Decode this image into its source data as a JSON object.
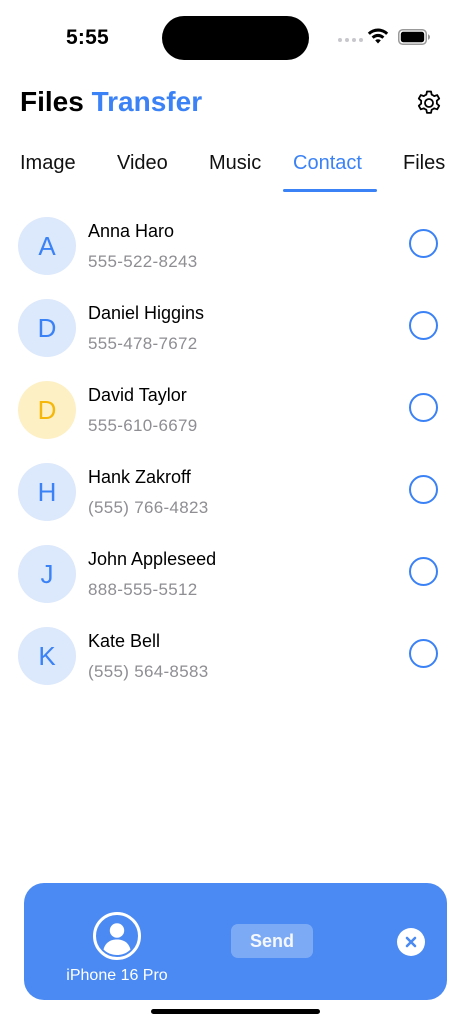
{
  "status_bar": {
    "time": "5:55",
    "icons": [
      "cellular-dots-icon",
      "wifi-icon",
      "battery-icon"
    ]
  },
  "header": {
    "title_part1": "Files",
    "title_part2": "Transfer",
    "settings_icon": "gear-icon"
  },
  "tabs": [
    {
      "label": "Image",
      "active": false
    },
    {
      "label": "Video",
      "active": false
    },
    {
      "label": "Music",
      "active": false
    },
    {
      "label": "Contact",
      "active": true
    },
    {
      "label": "Files",
      "active": false
    }
  ],
  "contacts": [
    {
      "initial": "A",
      "name": "Anna Haro",
      "phone": "555-522-8243",
      "avatar_color": "blue",
      "selected": false
    },
    {
      "initial": "D",
      "name": "Daniel Higgins",
      "phone": "555-478-7672",
      "avatar_color": "blue",
      "selected": false
    },
    {
      "initial": "D",
      "name": "David Taylor",
      "phone": "555-610-6679",
      "avatar_color": "yellow",
      "selected": false
    },
    {
      "initial": "H",
      "name": "Hank Zakroff",
      "phone": "(555) 766-4823",
      "avatar_color": "blue",
      "selected": false
    },
    {
      "initial": "J",
      "name": "John Appleseed",
      "phone": "888-555-5512",
      "avatar_color": "blue",
      "selected": false
    },
    {
      "initial": "K",
      "name": "Kate Bell",
      "phone": "(555) 564-8583",
      "avatar_color": "blue",
      "selected": false
    }
  ],
  "send_bar": {
    "device_name": "iPhone 16 Pro",
    "device_icon": "person-circle-icon",
    "send_label": "Send",
    "close_icon": "close-icon"
  },
  "colors": {
    "accent": "#3b82f6",
    "send_bar": "#4b8af2",
    "avatar_blue_bg": "#dce8fb",
    "avatar_yellow_bg": "#fdf0c5",
    "avatar_yellow_fg": "#f5b70a",
    "secondary_text": "#8e8e93"
  }
}
